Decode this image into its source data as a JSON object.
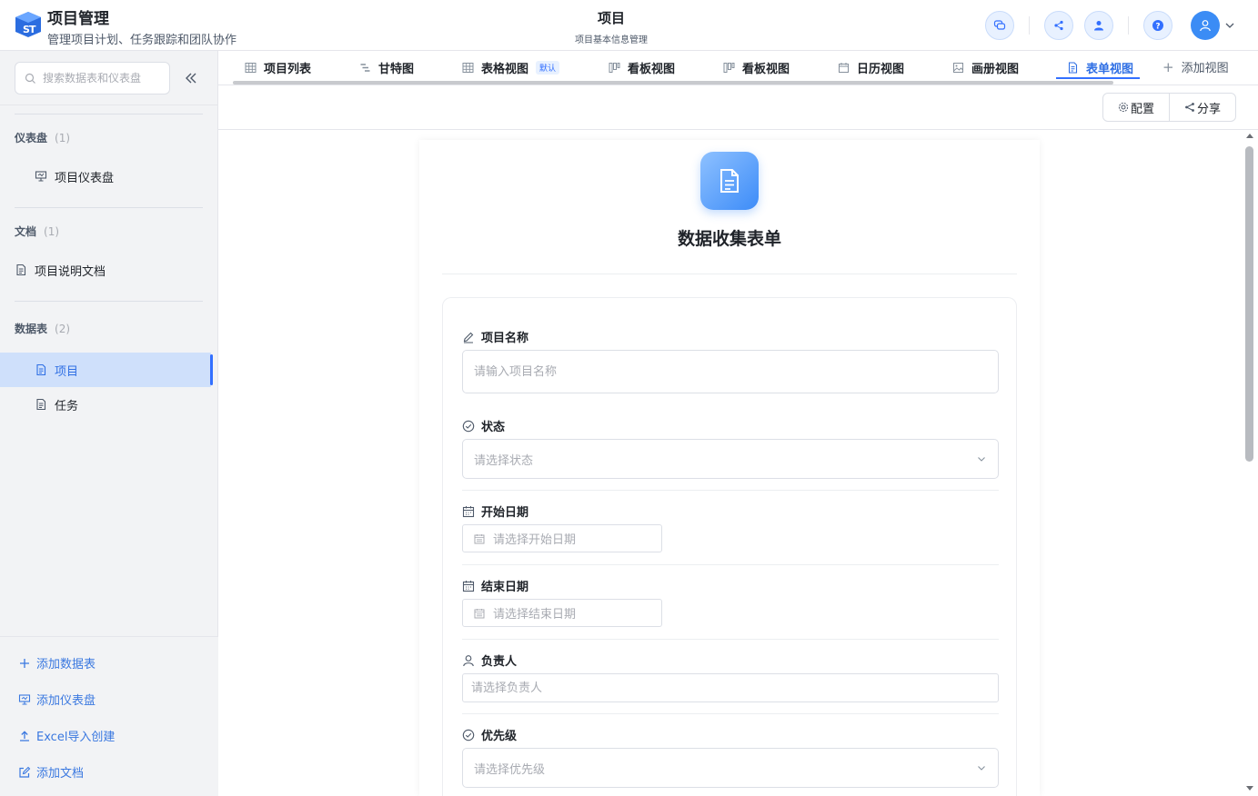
{
  "app": {
    "logo_text": "ST",
    "title": "项目管理",
    "subtitle": "管理项目计划、任务跟踪和团队协作"
  },
  "page": {
    "title": "项目",
    "subtitle": "项目基本信息管理"
  },
  "sidebar": {
    "search_placeholder": "搜索数据表和仪表盘",
    "sections": [
      {
        "title": "仪表盘",
        "count": "(1)",
        "items": [
          {
            "label": "项目仪表盘",
            "icon": "dashboard-icon"
          }
        ]
      },
      {
        "title": "文档",
        "count": "(1)",
        "items": [
          {
            "label": "项目说明文档",
            "icon": "document-icon"
          }
        ]
      },
      {
        "title": "数据表",
        "count": "(2)",
        "items": [
          {
            "label": "项目",
            "icon": "table-doc-icon",
            "active": true
          },
          {
            "label": "任务",
            "icon": "table-doc-icon"
          }
        ]
      }
    ],
    "actions": [
      {
        "label": "添加数据表",
        "icon": "plus-icon"
      },
      {
        "label": "添加仪表盘",
        "icon": "dashboard-icon"
      },
      {
        "label": "Excel导入创建",
        "icon": "upload-icon"
      },
      {
        "label": "添加文档",
        "icon": "edit-icon"
      }
    ]
  },
  "tabs": [
    {
      "label": "项目列表",
      "icon": "grid-icon"
    },
    {
      "label": "甘特图",
      "icon": "gantt-icon"
    },
    {
      "label": "表格视图",
      "icon": "grid-icon",
      "badge": "默认"
    },
    {
      "label": "看板视图",
      "icon": "kanban-icon"
    },
    {
      "label": "看板视图",
      "icon": "kanban-icon"
    },
    {
      "label": "日历视图",
      "icon": "calendar-icon"
    },
    {
      "label": "画册视图",
      "icon": "image-icon"
    },
    {
      "label": "表单视图",
      "icon": "form-icon",
      "active": true
    }
  ],
  "add_view_label": "添加视图",
  "toolbar": {
    "config_label": "配置",
    "share_label": "分享"
  },
  "form": {
    "title": "数据收集表单",
    "fields": [
      {
        "label": "项目名称",
        "icon": "pen-icon",
        "type": "text",
        "placeholder": "请输入项目名称"
      },
      {
        "label": "状态",
        "icon": "check-circle-icon",
        "type": "select",
        "placeholder": "请选择状态"
      },
      {
        "label": "开始日期",
        "icon": "calendar-icon",
        "type": "date",
        "placeholder": "请选择开始日期"
      },
      {
        "label": "结束日期",
        "icon": "calendar-icon",
        "type": "date",
        "placeholder": "请选择结束日期"
      },
      {
        "label": "负责人",
        "icon": "user-icon",
        "type": "text",
        "placeholder": "请选择负责人"
      },
      {
        "label": "优先级",
        "icon": "check-circle-icon",
        "type": "select",
        "placeholder": "请选择优先级"
      }
    ]
  },
  "colors": {
    "accent": "#3370ff",
    "active_bg": "#cfe0fb",
    "sidebar_bg": "#f2f3f5"
  }
}
